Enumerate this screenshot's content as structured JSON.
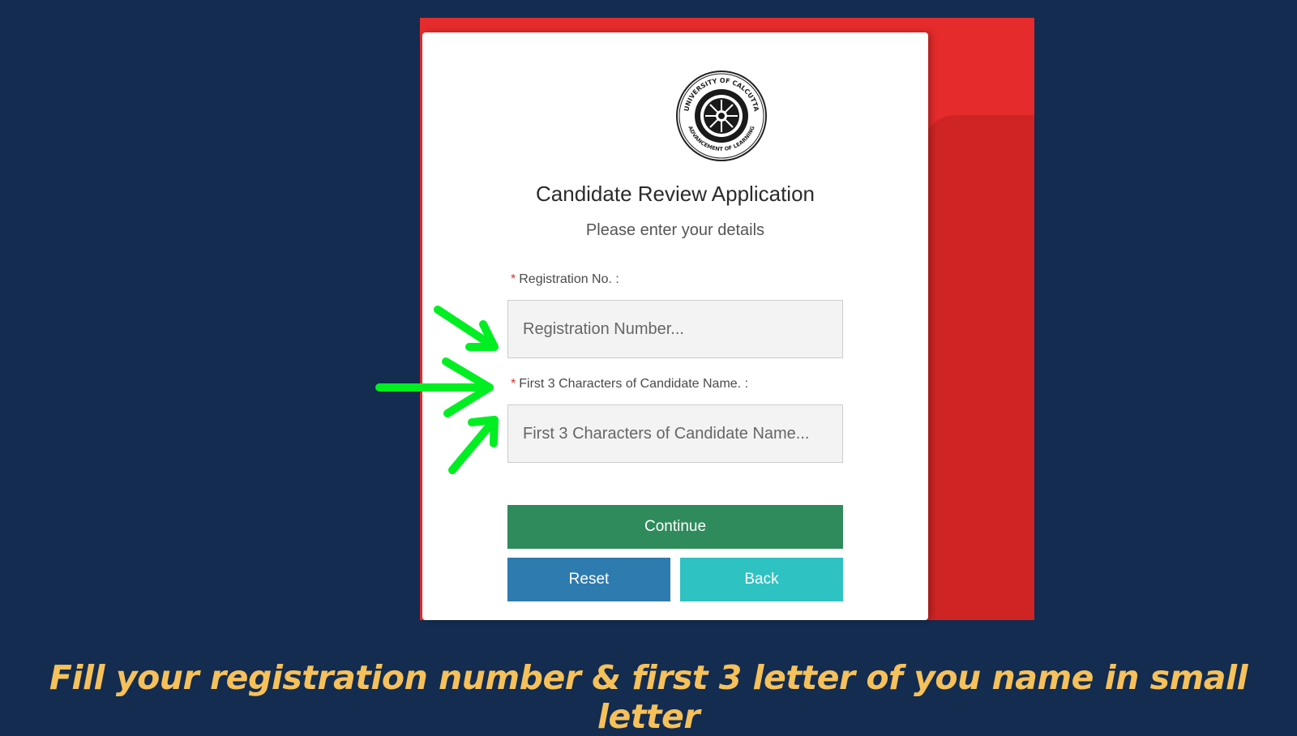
{
  "form": {
    "seal": {
      "icon": "university-seal-icon",
      "text_top": "UNIVERSITY OF CALCUTTA",
      "text_bottom": "ADVANCEMENT OF LEARNING"
    },
    "title": "Candidate Review Application",
    "subtitle": "Please enter your details",
    "registration": {
      "required_mark": "*",
      "label": "Registration No. :",
      "placeholder": "Registration Number...",
      "value": ""
    },
    "name_chars": {
      "required_mark": "*",
      "label": "First 3 Characters of Candidate Name. :",
      "placeholder": "First 3 Characters of Candidate Name...",
      "value": ""
    },
    "continue_label": "Continue",
    "reset_label": "Reset",
    "back_label": "Back"
  },
  "annotation": {
    "arrow_color": "#00ee22",
    "arrow_icon": "green-arrow-icon"
  },
  "caption": "Fill your registration number & first 3 letter of you name in small letter",
  "colors": {
    "background": "#132c50",
    "frame": "#e52b2b",
    "continue": "#2f8b5b",
    "reset": "#2e7bb0",
    "back": "#2fc2c2",
    "caption": "#f6c15a"
  }
}
